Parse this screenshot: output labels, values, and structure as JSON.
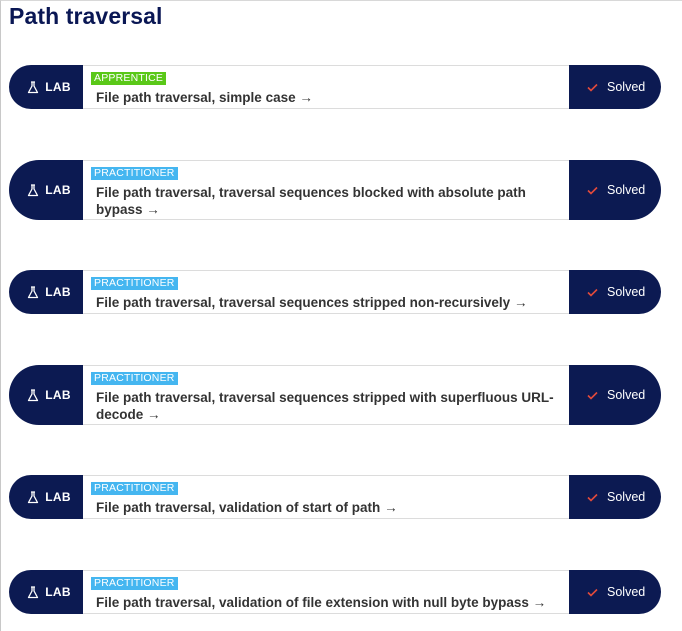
{
  "section": {
    "title": "Path traversal"
  },
  "labs": [
    {
      "type_label": "LAB",
      "level": "APPRENTICE",
      "level_kind": "apprentice",
      "title": "File path traversal, simple case",
      "arrow": "→",
      "status": "Solved"
    },
    {
      "type_label": "LAB",
      "level": "PRACTITIONER",
      "level_kind": "practitioner",
      "title": "File path traversal, traversal sequences blocked with absolute path bypass",
      "arrow": "→",
      "status": "Solved"
    },
    {
      "type_label": "LAB",
      "level": "PRACTITIONER",
      "level_kind": "practitioner",
      "title": "File path traversal, traversal sequences stripped non-recursively",
      "arrow": "→",
      "status": "Solved"
    },
    {
      "type_label": "LAB",
      "level": "PRACTITIONER",
      "level_kind": "practitioner",
      "title": "File path traversal, traversal sequences stripped with superfluous URL-decode",
      "arrow": "→",
      "status": "Solved"
    },
    {
      "type_label": "LAB",
      "level": "PRACTITIONER",
      "level_kind": "practitioner",
      "title": "File path traversal, validation of start of path",
      "arrow": "→",
      "status": "Solved"
    },
    {
      "type_label": "LAB",
      "level": "PRACTITIONER",
      "level_kind": "practitioner",
      "title": "File path traversal, validation of file extension with null byte bypass",
      "arrow": "→",
      "status": "Solved"
    }
  ],
  "icons": {
    "lab": "flask-icon",
    "status": "check-icon"
  },
  "colors": {
    "navy": "#0c1a52",
    "apprentice": "#5ac818",
    "practitioner": "#45b6f0",
    "check": "#e24a3b",
    "title": "#0a1754"
  }
}
